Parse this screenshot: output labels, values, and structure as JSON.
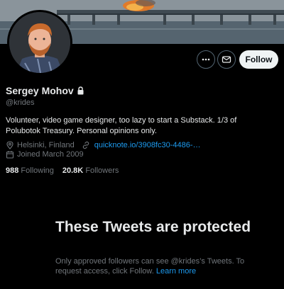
{
  "profile": {
    "name": "Sergey Mohov",
    "handle": "@krides",
    "bio": "Volunteer, video game designer, too lazy to start a Substack. 1/3 of Polubotok Treasury. Personal opinions only.",
    "location": "Helsinki, Finland",
    "website": "quicknote.io/3908fc30-4486-…",
    "joined": "Joined March 2009",
    "following_count": "988",
    "following_label": "Following",
    "followers_count": "20.8K",
    "followers_label": "Followers",
    "locked": true
  },
  "actions": {
    "more_icon": "more-icon",
    "message_icon": "envelope-icon",
    "follow_label": "Follow"
  },
  "protected": {
    "title": "These Tweets are protected",
    "description": "Only approved followers can see @krides’s Tweets. To request access, click Follow.",
    "learn_more": "Learn more"
  },
  "colors": {
    "background": "#000000",
    "accent": "#1d9bf0",
    "secondary_text": "#71767b",
    "follow_button_bg": "#eff3f4"
  }
}
